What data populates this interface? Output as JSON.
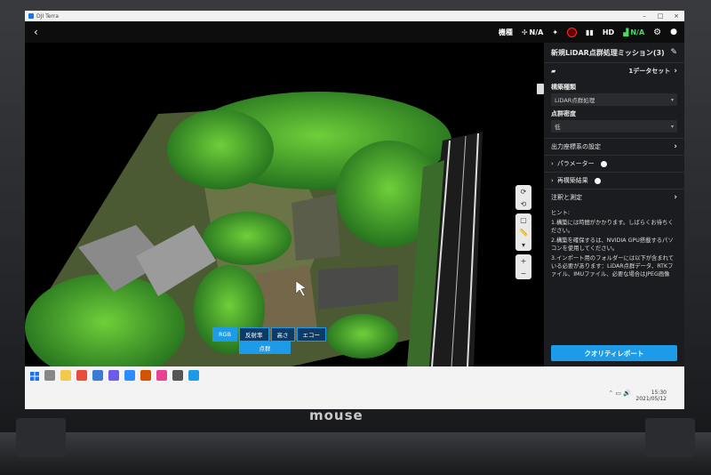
{
  "window": {
    "title": "DJI Terra"
  },
  "topbar": {
    "status": [
      {
        "icon": "antenna-icon",
        "label": "機種"
      },
      {
        "icon": "satellite-icon",
        "label": "N/A"
      },
      {
        "icon": "link-icon",
        "label": ""
      },
      {
        "icon": "signal-icon",
        "label": ""
      },
      {
        "icon": "hd-icon",
        "label": "HD"
      },
      {
        "icon": "battery-icon",
        "label": "N/A"
      }
    ]
  },
  "panel": {
    "title": "新規LiDAR点群処理ミッション(3)",
    "dataset_label": "1データセット",
    "type_label": "構築種類",
    "type_value": "LiDAR点群処理",
    "density_label": "点群密度",
    "density_value": "低",
    "output_coord": "出力座標系の設定",
    "params": "パラメーター",
    "rebuild": "再構築結果",
    "annotate": "注釈と測定",
    "hint_title": "ヒント:",
    "hints": [
      "1.構築には時間がかかります。しばらくお待ちください。",
      "2.構築を確保するは、NVIDIA GPU搭載するパソコンを使用してください。",
      "3.インポート用のフォルダーには以下が含まれている必要があります：LiDAR点群データ、RTKファイル、IMUファイル、必要な場合はJPEG画像"
    ],
    "quality_button": "クオリティレポート"
  },
  "modes": [
    "RGB",
    "反射率",
    "高さ",
    "エコー"
  ],
  "active_mode": "RGB",
  "pointcloud_button": "点群",
  "tray": {
    "time": "15:30",
    "date": "2021/05/12"
  },
  "brand": "mouse",
  "colors": {
    "accent": "#1e9be8",
    "panel_bg": "#1b1c1f",
    "ok": "#4cd964"
  }
}
